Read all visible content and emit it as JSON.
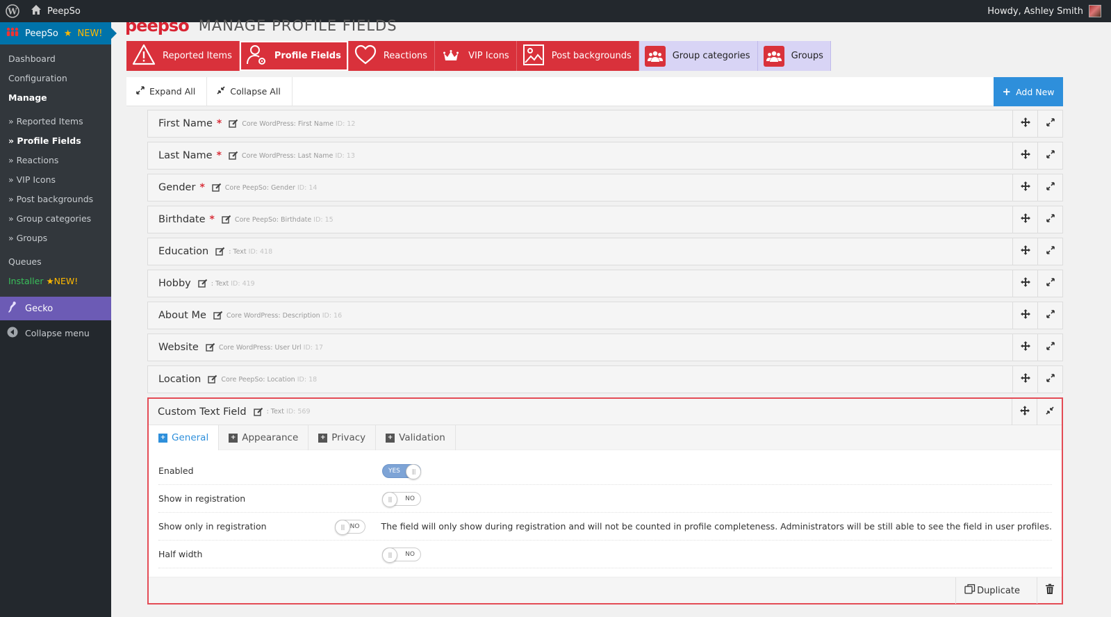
{
  "adminbar": {
    "site_name": "PeepSo",
    "howdy": "Howdy, Ashley Smith"
  },
  "menu": {
    "peepso_label": "PeepSo",
    "peepso_new": "NEW!",
    "items": [
      {
        "label": "Dashboard"
      },
      {
        "label": "Configuration"
      },
      {
        "label": "Manage"
      },
      {
        "label": "» Reported Items"
      },
      {
        "label": "» Profile Fields"
      },
      {
        "label": "» Reactions"
      },
      {
        "label": "» VIP Icons"
      },
      {
        "label": "» Post backgrounds"
      },
      {
        "label": "» Group categories"
      },
      {
        "label": "» Groups"
      },
      {
        "label": "Queues"
      }
    ],
    "installer_label": "Installer",
    "installer_new": "NEW!",
    "gecko_label": "Gecko",
    "collapse_label": "Collapse menu"
  },
  "page": {
    "brand": "peepso",
    "title": "MANAGE PROFILE FIELDS"
  },
  "tabs": [
    {
      "label": "Reported Items",
      "icon": "warning-icon"
    },
    {
      "label": "Profile Fields",
      "icon": "user-gear-icon"
    },
    {
      "label": "Reactions",
      "icon": "heart-icon"
    },
    {
      "label": "VIP Icons",
      "icon": "crown-icon"
    },
    {
      "label": "Post backgrounds",
      "icon": "image-icon"
    },
    {
      "label": "Group categories",
      "icon": "group-icon"
    },
    {
      "label": "Groups",
      "icon": "group-icon"
    }
  ],
  "toolbar": {
    "expand_all": "Expand All",
    "collapse_all": "Collapse All",
    "add_new": "Add New"
  },
  "fields": [
    {
      "name": "First Name",
      "required": "*",
      "meta": "Core WordPress: First Name",
      "id": "ID: 12"
    },
    {
      "name": "Last Name",
      "required": "*",
      "meta": "Core WordPress: Last Name",
      "id": "ID: 13"
    },
    {
      "name": "Gender",
      "required": "*",
      "meta": "Core PeepSo: Gender",
      "id": "ID: 14"
    },
    {
      "name": "Birthdate",
      "required": "*",
      "meta": "Core PeepSo: Birthdate",
      "id": "ID: 15"
    },
    {
      "name": "Education",
      "required": "",
      "meta": ": Text",
      "id": "ID: 418"
    },
    {
      "name": "Hobby",
      "required": "",
      "meta": ": Text",
      "id": "ID: 419"
    },
    {
      "name": "About Me",
      "required": "",
      "meta": "Core WordPress: Description",
      "id": "ID: 16"
    },
    {
      "name": "Website",
      "required": "",
      "meta": "Core WordPress: User Url",
      "id": "ID: 17"
    },
    {
      "name": "Location",
      "required": "",
      "meta": "Core PeepSo: Location",
      "id": "ID: 18"
    }
  ],
  "expanded": {
    "name": "Custom Text Field",
    "meta": ": Text",
    "id": "ID: 569",
    "subtabs": [
      "General",
      "Appearance",
      "Privacy",
      "Validation"
    ],
    "settings": [
      {
        "label": "Enabled",
        "value": "YES",
        "on": true,
        "note": ""
      },
      {
        "label": "Show in registration",
        "value": "NO",
        "on": false,
        "note": ""
      },
      {
        "label": "Show only in registration",
        "value": "NO",
        "on": false,
        "note": "The field will only show during registration and will not be counted in profile completeness. Administrators will be still able to see the field in user profiles."
      },
      {
        "label": "Half width",
        "value": "NO",
        "on": false,
        "note": ""
      }
    ],
    "duplicate_label": "Duplicate"
  },
  "colors": {
    "accent_red": "#d9313b",
    "accent_blue": "#2e8fdb",
    "lavender": "#d8d4f5",
    "admin_dark": "#23282d"
  }
}
